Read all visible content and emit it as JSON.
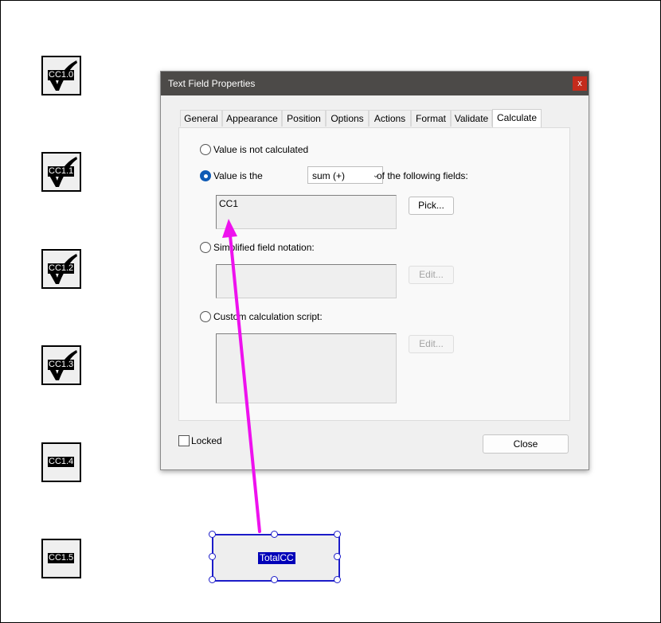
{
  "checkbox_fields": [
    {
      "name": "CC1.0",
      "checked": true
    },
    {
      "name": "CC1.1",
      "checked": true
    },
    {
      "name": "CC1.2",
      "checked": true
    },
    {
      "name": "CC1.3",
      "checked": true
    },
    {
      "name": "CC1.4",
      "checked": false
    },
    {
      "name": "CC1.5",
      "checked": false
    }
  ],
  "total_field": {
    "name": "TotalCC"
  },
  "dialog": {
    "title": "Text Field Properties",
    "close_glyph": "x",
    "tabs": [
      "General",
      "Appearance",
      "Position",
      "Options",
      "Actions",
      "Format",
      "Validate",
      "Calculate"
    ],
    "active_tab": "Calculate",
    "calculate": {
      "option_not_calculated": "Value is not calculated",
      "option_value_is": "Value is the",
      "operation_selected": "sum (+)",
      "following_fields_label": "of the following fields:",
      "fields_value": "CC1",
      "pick_button": "Pick...",
      "option_simplified": "Simplified field notation:",
      "simplified_value": "",
      "edit_button_1": "Edit...",
      "option_custom": "Custom calculation script:",
      "custom_value": "",
      "edit_button_2": "Edit...",
      "selected_option": "value_is"
    },
    "locked_label": "Locked",
    "locked_checked": false,
    "close_button": "Close"
  },
  "colors": {
    "annotation_arrow": "#ee11ee",
    "titlebar": "#4c4a48",
    "selection_blue": "#1c1cc9",
    "radio_accent": "#0f5bb5"
  }
}
